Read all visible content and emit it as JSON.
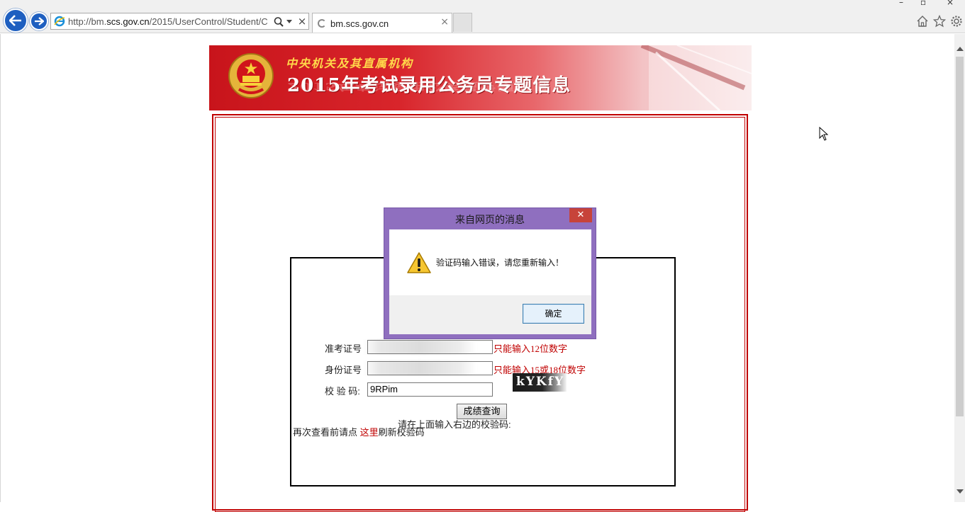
{
  "browser": {
    "url_prefix": "http://bm.",
    "url_host": "scs.gov.cn",
    "url_path": "/2015/UserControl/Student/C",
    "tab_title": "bm.scs.gov.cn",
    "close_glyph": "×",
    "window_controls": [
      "–",
      "▫",
      "×"
    ]
  },
  "banner": {
    "subtitle": "中央机关及其直属机构",
    "title": "2015年考试录用公务员专题信息",
    "reflection": "2015年考试录用公务员专题信息"
  },
  "form": {
    "exam_id_label": "准考证号",
    "exam_id_hint": "只能输入12位数字",
    "id_card_label": "身份证号",
    "id_card_hint": "只能输入15或18位数字",
    "verify_label": "校 验 码:",
    "verify_value": "9RPim",
    "captcha_prompt": "请在上面输入右边的校验码:",
    "captcha_text": "kYKfY",
    "query_button": "成绩查询",
    "refresh_prefix": "再次查看前请点 ",
    "refresh_link": "这里",
    "refresh_suffix": "刷新校验码"
  },
  "dialog": {
    "title": "来自网页的消息",
    "close_glyph": "✕",
    "message": "验证码输入错误，请您重新输入！",
    "ok_button": "确定"
  },
  "colors": {
    "accent_red": "#c00000",
    "dialog_frame": "#8f6fbf",
    "nav_blue": "#1e5fc0"
  }
}
